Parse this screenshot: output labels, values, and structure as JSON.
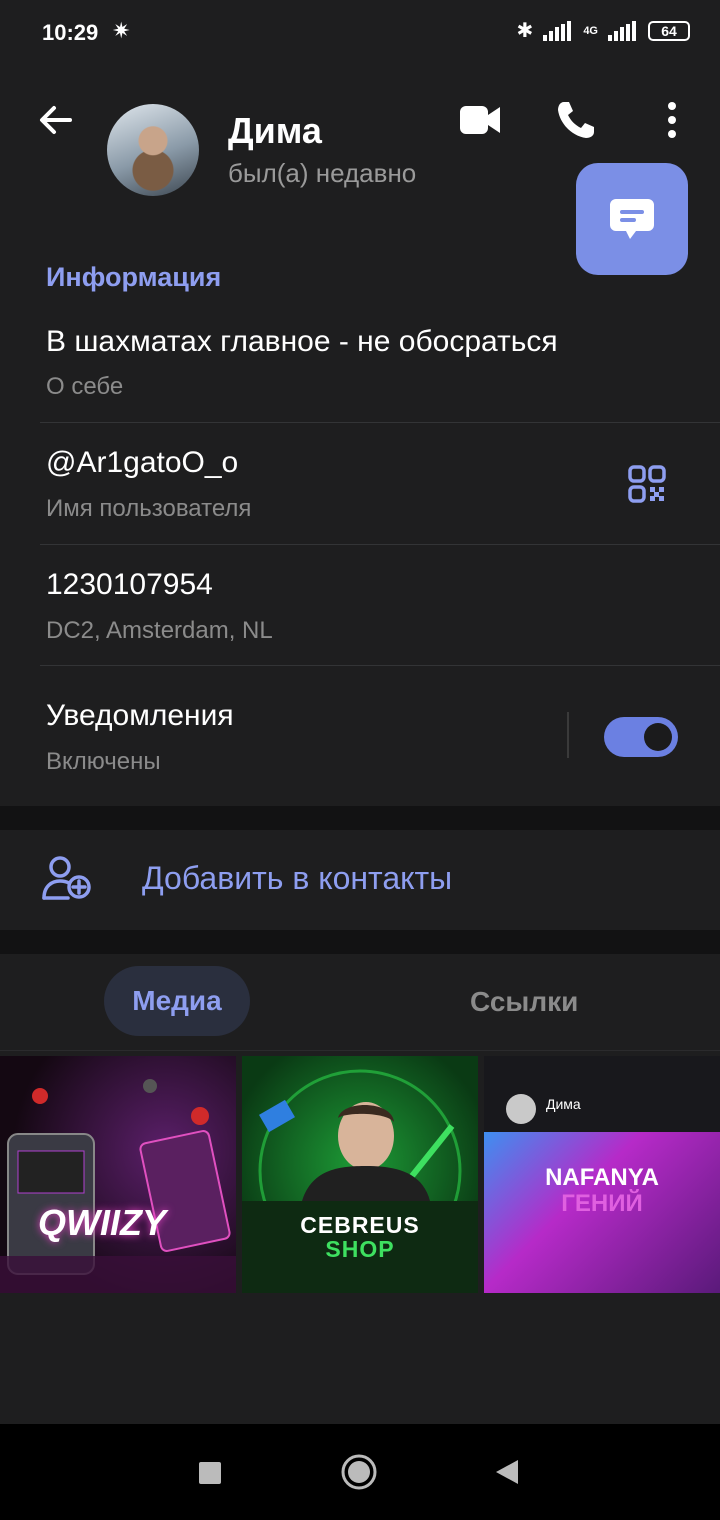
{
  "statusbar": {
    "time": "10:29",
    "battery": "64",
    "network": "4G"
  },
  "header": {
    "name": "Дима",
    "status": "был(а) недавно"
  },
  "info": {
    "section_title": "Информация",
    "bio": {
      "value": "В шахматах главное - не обосраться",
      "label": "О себе"
    },
    "username": {
      "value": "@Ar1gatoO_o",
      "label": "Имя пользователя"
    },
    "user_id": {
      "value": "1230107954",
      "label": "DC2, Amsterdam, NL"
    },
    "notifications": {
      "value": "Уведомления",
      "label": "Включены",
      "enabled": true
    }
  },
  "actions": {
    "add_contact": "Добавить в контакты"
  },
  "tabs": {
    "media": "Медиа",
    "links": "Ссылки",
    "active": "media"
  },
  "media": [
    {
      "caption": "QWIIZY"
    },
    {
      "caption_line1": "CEBREUS",
      "caption_line2": "SHOP"
    },
    {
      "caption_line1": "NAFANYA",
      "caption_line2": "ГЕНИЙ",
      "chat_name": "Дима"
    }
  ],
  "colors": {
    "accent": "#8e9ef0",
    "toggle": "#6b80e2",
    "fab": "#7b8fe6",
    "background": "#1e1e1f"
  }
}
